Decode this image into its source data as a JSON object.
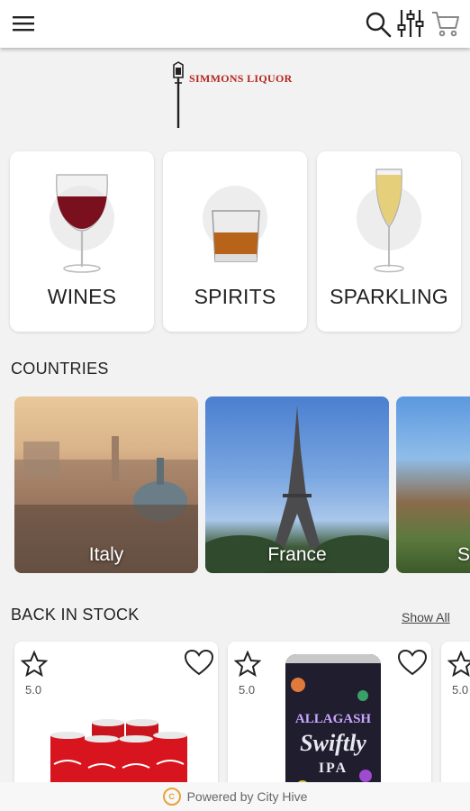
{
  "header": {
    "menu_icon": "hamburger-menu-icon",
    "search_icon": "search-icon",
    "filter_icon": "filter-sliders-icon",
    "cart_icon": "shopping-cart-icon"
  },
  "logo": {
    "text": "SIMMONS LIQUOR"
  },
  "categories": [
    {
      "label": "WINES"
    },
    {
      "label": "SPIRITS"
    },
    {
      "label": "SPARKLING"
    }
  ],
  "countries": {
    "title": "COUNTRIES",
    "items": [
      {
        "label": "Italy"
      },
      {
        "label": "France"
      },
      {
        "label": "S"
      }
    ]
  },
  "back_in_stock": {
    "title": "BACK IN STOCK",
    "show_all": "Show All",
    "products": [
      {
        "rating": "5.0",
        "image": "coca-cola-cans"
      },
      {
        "rating": "5.0",
        "image": "allagash-swiftly-ipa-can",
        "brand": "ALLAGASH",
        "name": "Swiftly",
        "style": "IPA"
      },
      {
        "rating": "5.0"
      }
    ]
  },
  "footer": {
    "text": "Powered by City Hive"
  },
  "colors": {
    "logo_red": "#b3261e",
    "accent_orange": "#e8a23a"
  }
}
